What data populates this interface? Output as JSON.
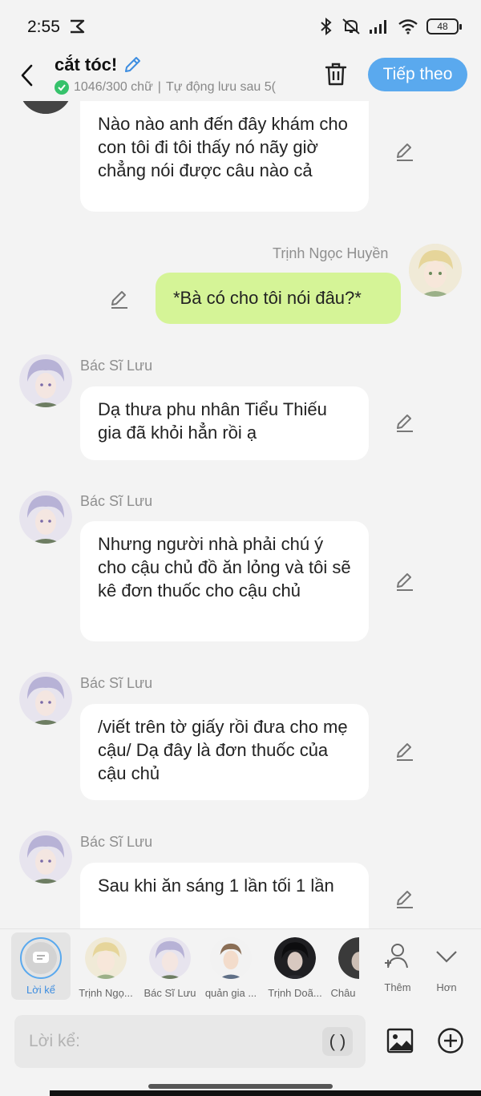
{
  "status": {
    "time": "2:55",
    "battery": "48"
  },
  "header": {
    "title": "cắt tóc!",
    "char_count": "1046/300 chữ",
    "separator": "|",
    "autosave": "Tự động lưu sau 5("
  },
  "actions": {
    "next_label": "Tiếp theo"
  },
  "messages": [
    {
      "sender": "",
      "text": "Nào nào anh đến đây khám cho con tôi đi tôi thấy nó nãy giờ chẳng nói được câu nào cả"
    },
    {
      "sender": "Trịnh Ngọc Huyền",
      "text": "*Bà có cho tôi nói đâu?*"
    },
    {
      "sender": "Bác Sĩ Lưu",
      "text": "Dạ thưa phu nhân Tiểu Thiếu gia đã khỏi hẳn rồi ạ"
    },
    {
      "sender": "Bác Sĩ Lưu",
      "text": "Nhưng người nhà phải chú ý cho cậu chủ đồ ăn lỏng và tôi sẽ kê đơn thuốc cho cậu chủ"
    },
    {
      "sender": "Bác Sĩ Lưu",
      "text": "/viết trên tờ giấy rồi đưa cho mẹ cậu/ Dạ đây là đơn thuốc của cậu chủ"
    },
    {
      "sender": "Bác Sĩ Lưu",
      "text": "Sau khi ăn sáng 1 lần tối 1 lần"
    }
  ],
  "characters": {
    "narration": "Lời kể",
    "items": [
      "Trịnh Ngọ...",
      "Bác Sĩ Lưu",
      "quản gia ...",
      "Trịnh Doã...",
      "Châu"
    ],
    "add_label": "Thêm",
    "more_label": "Hơn"
  },
  "input": {
    "placeholder": "Lời kể:",
    "paren_label": "( )"
  },
  "colors": {
    "accent": "#5aa9ee",
    "my_bubble": "#d5f497",
    "other_bubble": "#ffffff",
    "background": "#f3f3f3"
  }
}
